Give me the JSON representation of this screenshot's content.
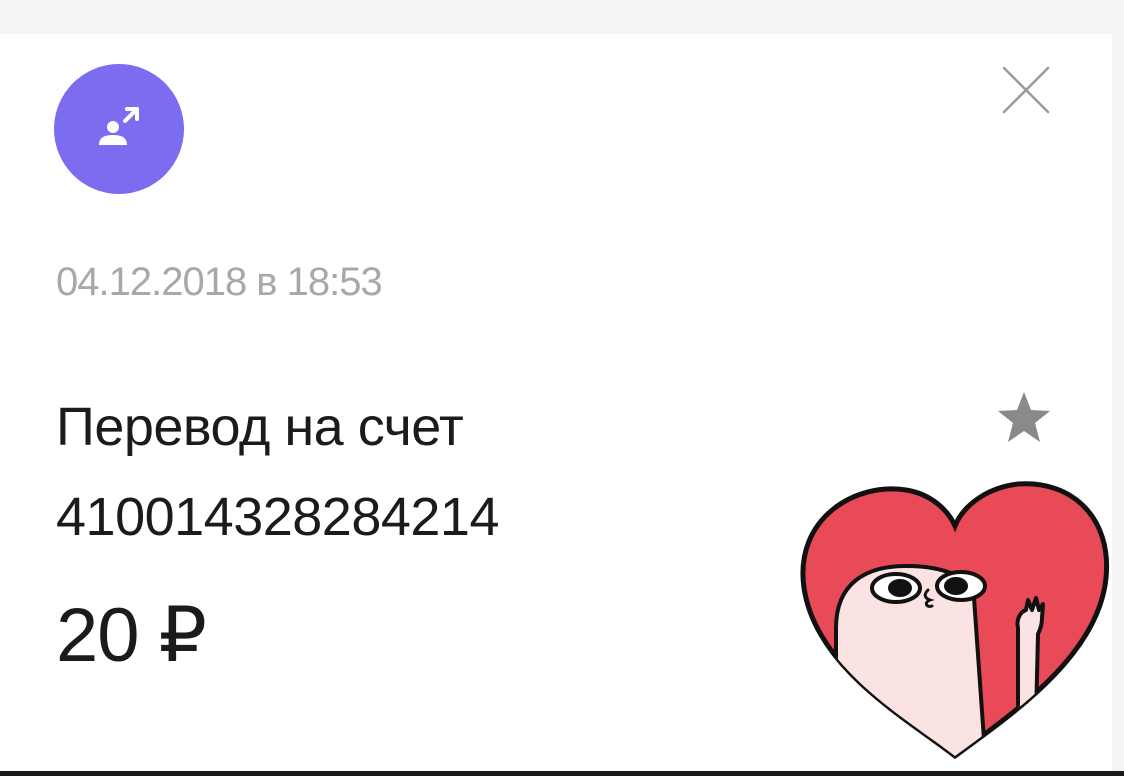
{
  "operation": {
    "type_icon": "person-transfer-out-icon",
    "date": "04.12.2018 в 18:53",
    "title_line1": "Перевод на счет",
    "title_line2": "410014328284214",
    "amount": "20 ₽"
  },
  "actions": {
    "close_icon": "close-icon",
    "favorite_icon": "star-icon"
  },
  "sticker": {
    "name": "heart-character-sticker"
  },
  "colors": {
    "avatar_bg": "#7b6cf0",
    "date_text": "#a8a8a8",
    "main_text": "#1b1b1b",
    "heart_fill": "#e84a57",
    "star": "#8a8a8a"
  }
}
